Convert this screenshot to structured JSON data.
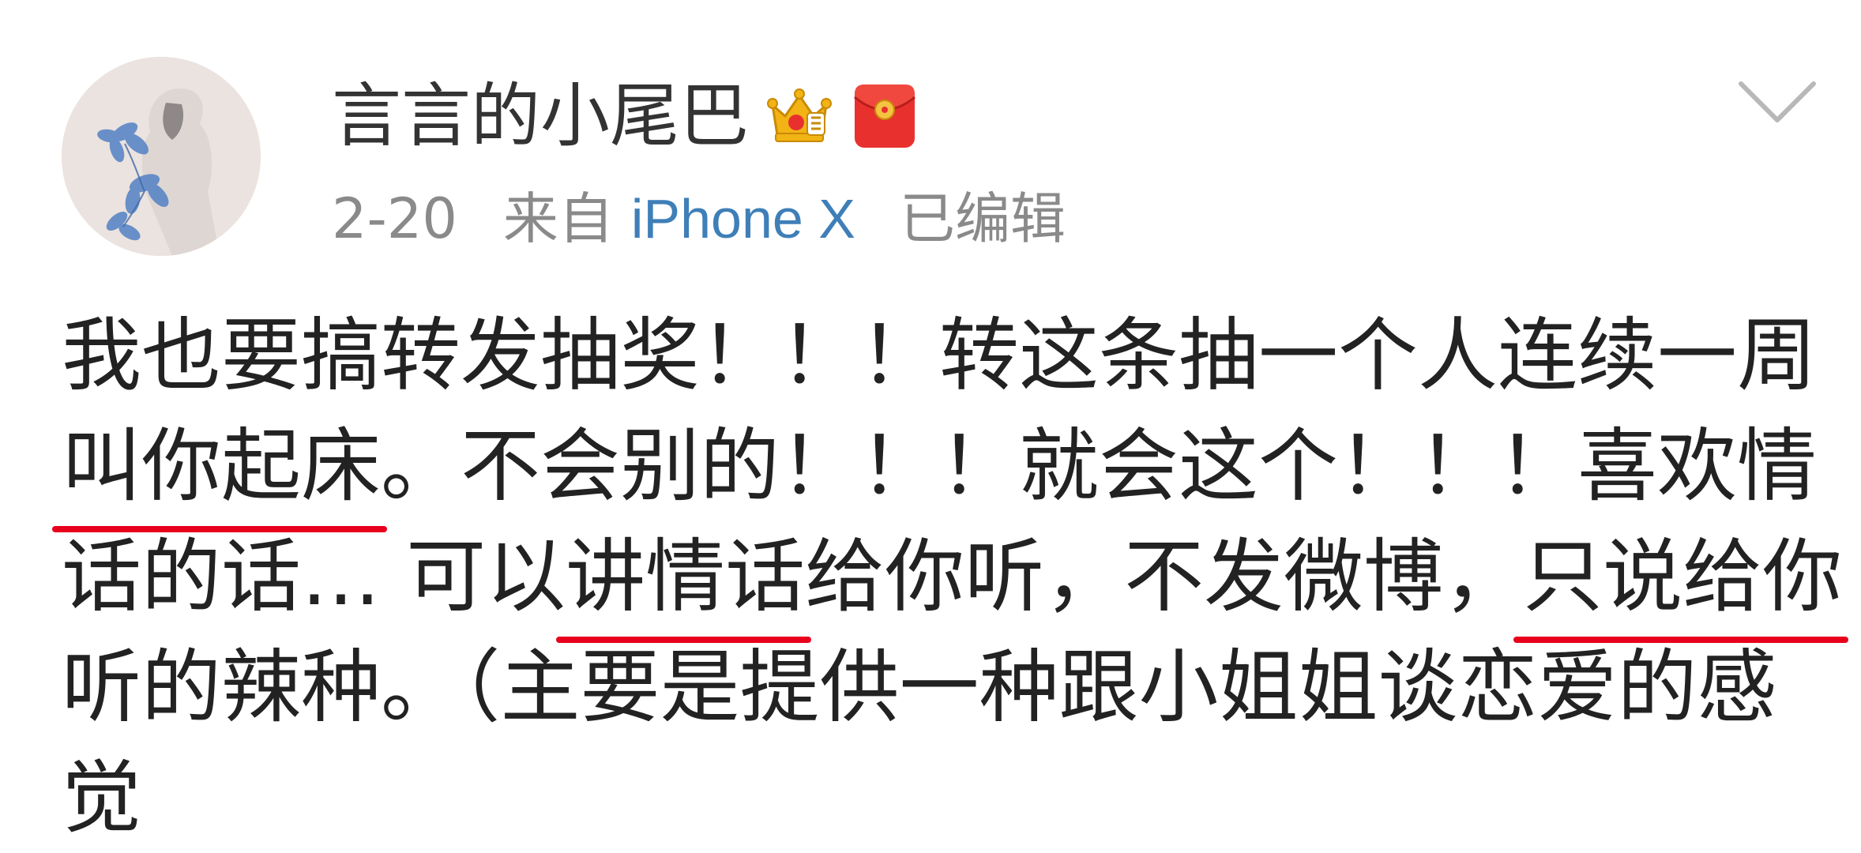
{
  "post": {
    "username": "言言的小尾巴",
    "date": "2-20",
    "from_label": "来自",
    "device": "iPhone X",
    "edited_label": "已编辑",
    "icons": {
      "crown_badge": "crown-badge-icon",
      "red_packet_badge": "red-packet-icon",
      "menu_chevron": "chevron-down-icon"
    },
    "lines": [
      [
        {
          "text": "我也要搞转发抽奖！！！转这条抽一个人连续一周",
          "underline": false
        }
      ],
      [
        {
          "text": "叫你起床",
          "underline": true
        },
        {
          "text": "。不会别的！！！就会这个！！！喜欢情",
          "underline": false
        }
      ],
      [
        {
          "text": "话的话… 可以",
          "underline": false
        },
        {
          "text": "讲情话",
          "underline": true
        },
        {
          "text": "给你听，不发微博，",
          "underline": false
        },
        {
          "text": "只说给你",
          "underline": true
        }
      ],
      [
        {
          "text": "听的辣种。（主要是提供一种跟小姐姐谈恋爱的感",
          "underline": false
        }
      ],
      [
        {
          "text": "觉",
          "underline": false
        }
      ]
    ]
  },
  "colors": {
    "text": "#222222",
    "meta_gray": "#8a8a8a",
    "device_link": "#3f7fb8",
    "underline_red": "#e8001c",
    "crown_gold": "#f2b315",
    "red_packet": "#e8312f"
  }
}
